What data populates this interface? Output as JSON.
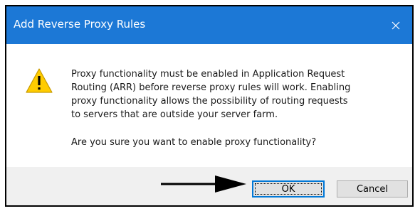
{
  "dialog": {
    "title": "Add Reverse Proxy Rules",
    "close_symbol": "✕",
    "icon": "warning-icon",
    "message_lines": [
      "Proxy functionality must be enabled in Application Request",
      "Routing (ARR) before reverse proxy rules will work. Enabling",
      "proxy functionality allows the possibility of routing requests",
      "to servers that are outside your server farm."
    ],
    "question": "Are you sure you want to enable proxy functionality?",
    "buttons": {
      "ok_label": "OK",
      "cancel_label": "Cancel"
    }
  },
  "colors": {
    "title_bar": "#1c78d6",
    "footer": "#f0f0f0",
    "warning_fill": "#ffcc00",
    "ok_border": "#0078d7"
  }
}
